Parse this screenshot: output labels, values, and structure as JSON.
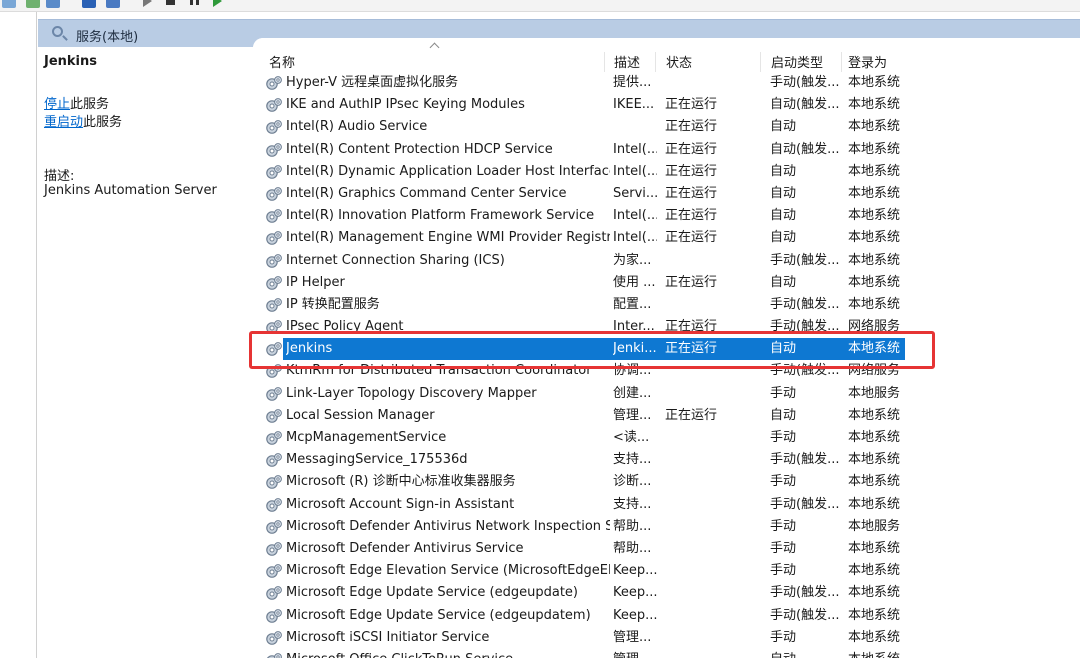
{
  "header": {
    "title": "服务(本地)"
  },
  "selected_service": {
    "name": "Jenkins",
    "actions": [
      {
        "link": "停止",
        "rest": "此服务"
      },
      {
        "link": "重启动",
        "rest": "此服务"
      }
    ],
    "description_label": "描述:",
    "description": "Jenkins Automation Server"
  },
  "columns": {
    "name": "名称",
    "description": "描述",
    "status": "状态",
    "startup_type": "启动类型",
    "log_on_as": "登录为"
  },
  "services": [
    {
      "name": "Hyper-V 远程桌面虚拟化服务",
      "desc": "提供...",
      "status": "",
      "start": "手动(触发...",
      "logon": "本地系统"
    },
    {
      "name": "IKE and AuthIP IPsec Keying Modules",
      "desc": "IKEE...",
      "status": "正在运行",
      "start": "自动(触发...",
      "logon": "本地系统"
    },
    {
      "name": "Intel(R) Audio Service",
      "desc": "",
      "status": "正在运行",
      "start": "自动",
      "logon": "本地系统"
    },
    {
      "name": "Intel(R) Content Protection HDCP Service",
      "desc": "Intel(...",
      "status": "正在运行",
      "start": "自动(触发...",
      "logon": "本地系统"
    },
    {
      "name": "Intel(R) Dynamic Application Loader Host Interface Se...",
      "desc": "Intel(...",
      "status": "正在运行",
      "start": "自动",
      "logon": "本地系统"
    },
    {
      "name": "Intel(R) Graphics Command Center Service",
      "desc": "Servi...",
      "status": "正在运行",
      "start": "自动",
      "logon": "本地系统"
    },
    {
      "name": "Intel(R) Innovation Platform Framework Service",
      "desc": "Intel(...",
      "status": "正在运行",
      "start": "自动",
      "logon": "本地系统"
    },
    {
      "name": "Intel(R) Management Engine WMI Provider Registration",
      "desc": "Intel(...",
      "status": "正在运行",
      "start": "自动",
      "logon": "本地系统"
    },
    {
      "name": "Internet Connection Sharing (ICS)",
      "desc": "为家...",
      "status": "",
      "start": "手动(触发...",
      "logon": "本地系统"
    },
    {
      "name": "IP Helper",
      "desc": "使用 ...",
      "status": "正在运行",
      "start": "自动",
      "logon": "本地系统"
    },
    {
      "name": "IP 转换配置服务",
      "desc": "配置...",
      "status": "",
      "start": "手动(触发...",
      "logon": "本地系统"
    },
    {
      "name": "IPsec Policy Agent",
      "desc": "Inter...",
      "status": "正在运行",
      "start": "手动(触发...",
      "logon": "网络服务"
    },
    {
      "name": "Jenkins",
      "desc": "Jenki...",
      "status": "正在运行",
      "start": "自动",
      "logon": "本地系统",
      "selected": true
    },
    {
      "name": "KtmRm for Distributed Transaction Coordinator",
      "desc": "协调...",
      "status": "",
      "start": "手动(触发...",
      "logon": "网络服务"
    },
    {
      "name": "Link-Layer Topology Discovery Mapper",
      "desc": "创建...",
      "status": "",
      "start": "手动",
      "logon": "本地服务"
    },
    {
      "name": "Local Session Manager",
      "desc": "管理...",
      "status": "正在运行",
      "start": "自动",
      "logon": "本地系统"
    },
    {
      "name": "McpManagementService",
      "desc": "<读...",
      "status": "",
      "start": "手动",
      "logon": "本地系统"
    },
    {
      "name": "MessagingService_175536d",
      "desc": "支持...",
      "status": "",
      "start": "手动(触发...",
      "logon": "本地系统"
    },
    {
      "name": "Microsoft (R) 诊断中心标准收集器服务",
      "desc": "诊断...",
      "status": "",
      "start": "手动",
      "logon": "本地系统"
    },
    {
      "name": "Microsoft Account Sign-in Assistant",
      "desc": "支持...",
      "status": "",
      "start": "手动(触发...",
      "logon": "本地系统"
    },
    {
      "name": "Microsoft Defender Antivirus Network Inspection Serv...",
      "desc": "帮助...",
      "status": "",
      "start": "手动",
      "logon": "本地服务"
    },
    {
      "name": "Microsoft Defender Antivirus Service",
      "desc": "帮助...",
      "status": "",
      "start": "手动",
      "logon": "本地系统"
    },
    {
      "name": "Microsoft Edge Elevation Service (MicrosoftEdgeElevat...",
      "desc": "Keep...",
      "status": "",
      "start": "手动",
      "logon": "本地系统"
    },
    {
      "name": "Microsoft Edge Update Service (edgeupdate)",
      "desc": "Keep...",
      "status": "",
      "start": "手动(触发...",
      "logon": "本地系统"
    },
    {
      "name": "Microsoft Edge Update Service (edgeupdatem)",
      "desc": "Keep...",
      "status": "",
      "start": "手动(触发...",
      "logon": "本地系统"
    },
    {
      "name": "Microsoft iSCSI Initiator Service",
      "desc": "管理...",
      "status": "",
      "start": "手动",
      "logon": "本地系统"
    },
    {
      "name": "Microsoft Office ClickToRun Service",
      "desc": "管理...",
      "status": "",
      "start": "自动",
      "logon": "本地系统"
    }
  ]
}
